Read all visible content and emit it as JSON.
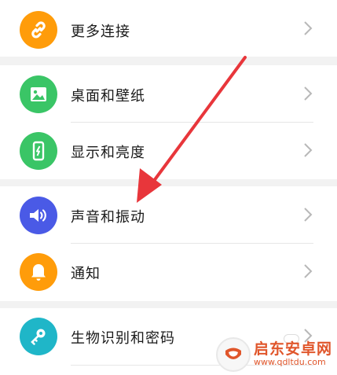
{
  "settings": {
    "items": [
      {
        "label": "更多连接",
        "icon": "link-icon",
        "color": "#ff9c0a"
      },
      {
        "label": "桌面和壁纸",
        "icon": "image-icon",
        "color": "#3ac566"
      },
      {
        "label": "显示和亮度",
        "icon": "phone-brightness-icon",
        "color": "#3ac566"
      },
      {
        "label": "声音和振动",
        "icon": "speaker-icon",
        "color": "#4a5ae6"
      },
      {
        "label": "通知",
        "icon": "bell-icon",
        "color": "#ff9c0a"
      },
      {
        "label": "生物识别和密码",
        "icon": "key-icon",
        "color": "#1fb6c8"
      }
    ]
  },
  "watermark": {
    "title": "启东安卓网",
    "url": "www.qdltdu.com"
  },
  "colors": {
    "arrow": "#e8363b",
    "background": "#f2f2f2",
    "chevron": "#b8b8b8"
  }
}
